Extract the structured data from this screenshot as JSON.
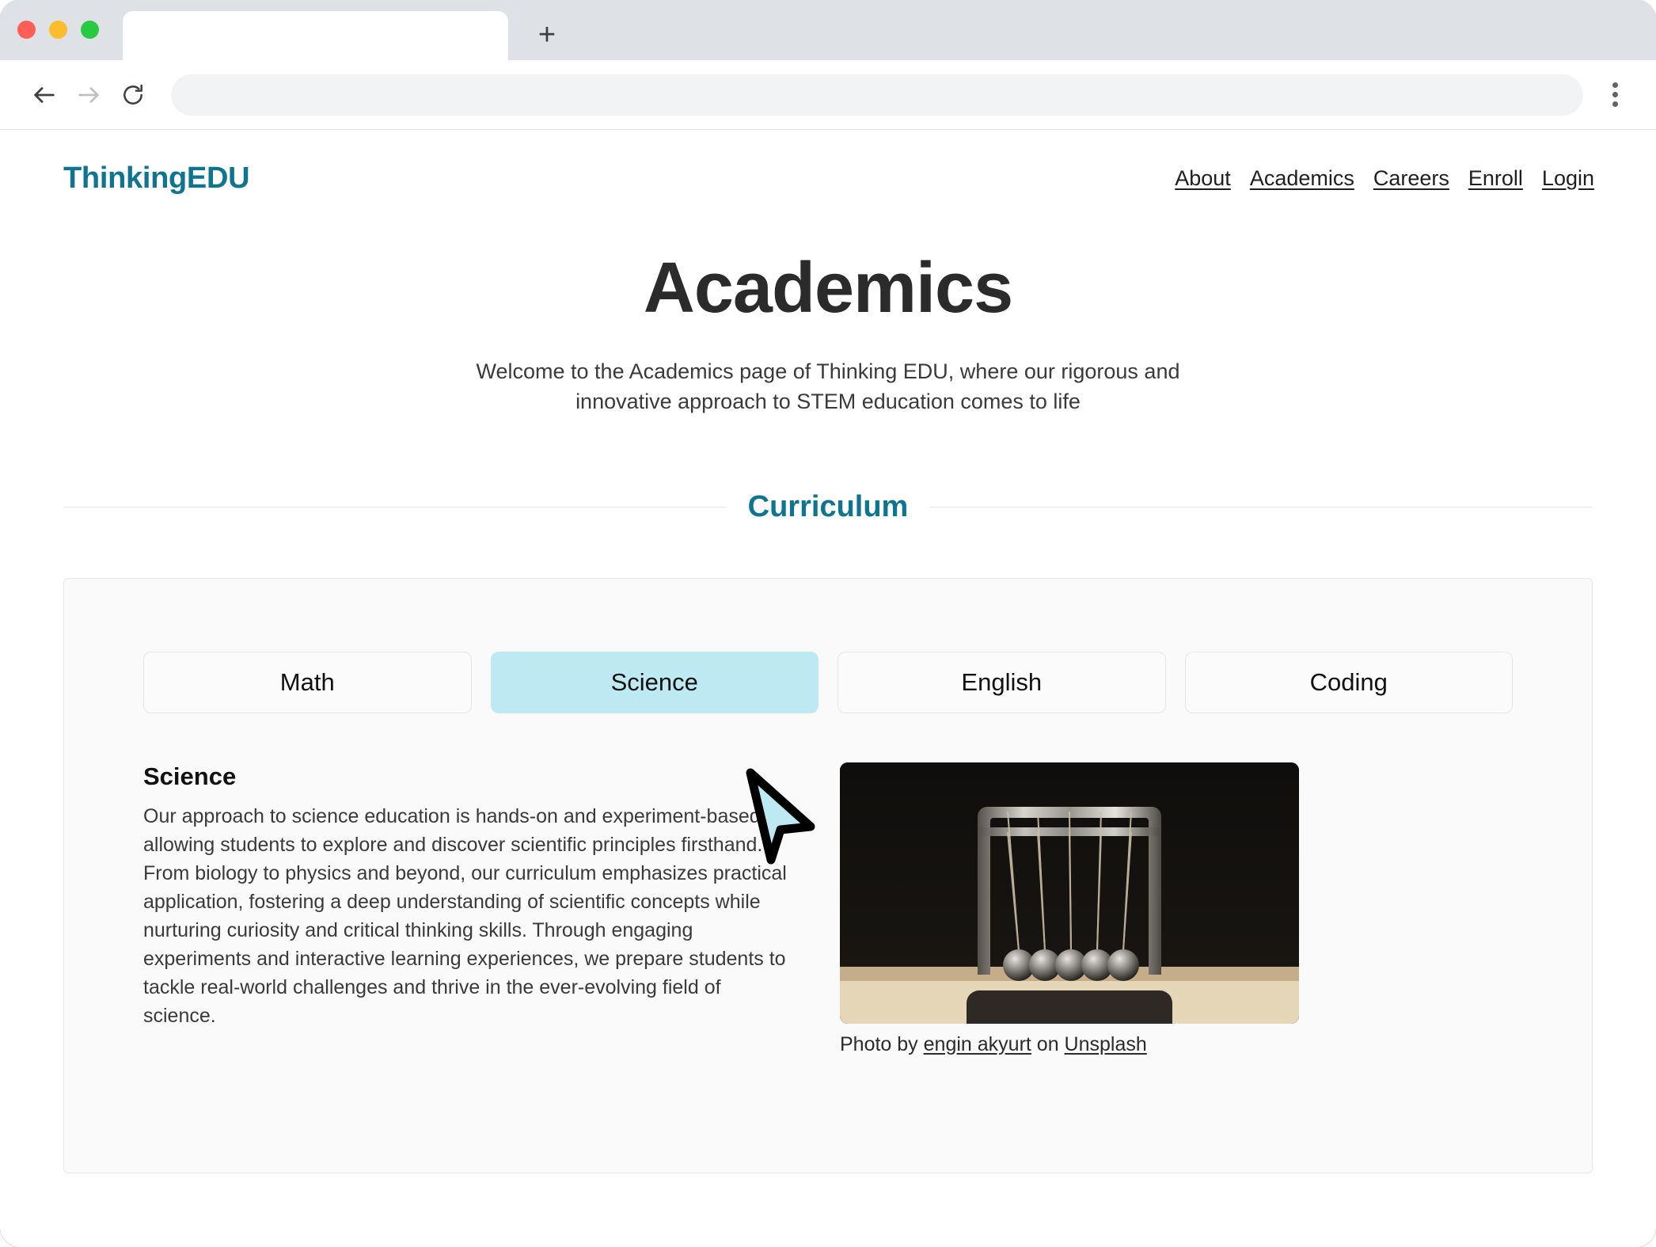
{
  "browser": {
    "tab_title": "",
    "address_value": "",
    "address_placeholder": "",
    "back_icon": "back-arrow-icon",
    "forward_icon": "forward-arrow-icon",
    "reload_icon": "reload-icon",
    "newtab_label": "+",
    "menu_icon": "three-dot-menu-icon"
  },
  "site": {
    "logo": "ThinkingEDU",
    "logo_color": "#0e7490",
    "nav": [
      {
        "label": "About"
      },
      {
        "label": "Academics"
      },
      {
        "label": "Careers"
      },
      {
        "label": "Enroll"
      },
      {
        "label": "Login"
      }
    ]
  },
  "hero": {
    "title": "Academics",
    "subtitle": "Welcome to the Academics page of Thinking EDU, where our rigorous and innovative approach to STEM education comes to life"
  },
  "section": {
    "divider_title": "Curriculum"
  },
  "curriculum": {
    "tabs": [
      {
        "label": "Math",
        "active": false
      },
      {
        "label": "Science",
        "active": true
      },
      {
        "label": "English",
        "active": false
      },
      {
        "label": "Coding",
        "active": false
      }
    ],
    "active_tab_color": "#bdeaf2",
    "panel": {
      "heading": "Science",
      "body": "Our approach to science education is hands-on and experiment-based, allowing students to explore and discover scientific principles firsthand. From biology to physics and beyond, our curriculum emphasizes practical application, fostering a deep understanding of scientific concepts while nurturing curiosity and critical thinking skills. Through engaging experiments and interactive learning experiences, we prepare students to tackle real-world challenges and thrive in the ever-evolving field of science.",
      "image_alt": "newtons-cradle-photo",
      "credit_prefix": "Photo by ",
      "credit_author": "engin akyurt",
      "credit_middle": " on ",
      "credit_source": "Unsplash"
    }
  }
}
